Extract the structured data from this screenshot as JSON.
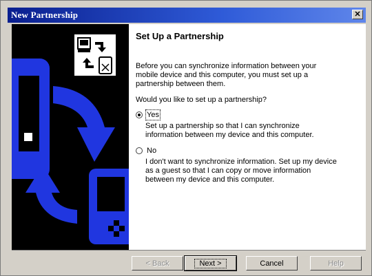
{
  "window": {
    "title": "New Partnership",
    "close_glyph": "✕"
  },
  "main": {
    "heading": "Set Up a Partnership",
    "intro": "Before you can synchronize information between your mobile device and this computer, you must set up a partnership between them.",
    "question": "Would you like to set up a partnership?",
    "options": [
      {
        "label": "Yes",
        "selected": true,
        "description": "Set up a partnership so that I can synchronize information between my device and this computer."
      },
      {
        "label": "No",
        "selected": false,
        "description": "I don't want to synchronize information. Set up my device as a guest so that I can copy or move information between my device and this computer."
      }
    ]
  },
  "buttons": {
    "back": "< Back",
    "next": "Next >",
    "cancel": "Cancel",
    "help": "Help"
  },
  "icons": {
    "sync": "sync-devices-icon",
    "artwork": "device-artwork"
  },
  "colors": {
    "title_bar": "#0a1f8f",
    "side_panel": "#000000",
    "artwork_blue": "#2036e0",
    "dialog_face": "#d4d0c8"
  }
}
